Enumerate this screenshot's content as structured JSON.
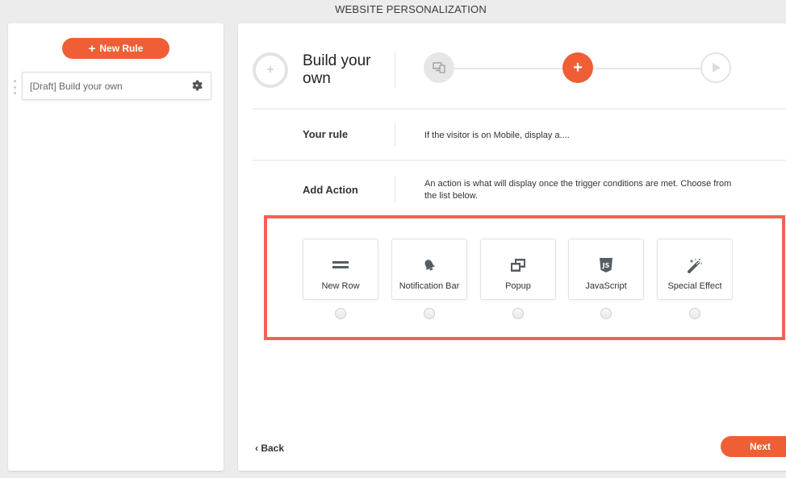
{
  "app": {
    "title": "WEBSITE PERSONALIZATION"
  },
  "sidebar": {
    "new_rule_button": {
      "icon": "plus-icon",
      "label": "New Rule"
    },
    "rules": [
      {
        "label": "[Draft] Build your own",
        "icon": "gear-icon"
      }
    ]
  },
  "main": {
    "header": {
      "icon": "plus-circle-icon",
      "title": "Build your own"
    },
    "stepper": {
      "steps": [
        {
          "name": "devices",
          "icon": "devices-icon",
          "state": "complete"
        },
        {
          "name": "action",
          "icon": "plus-icon",
          "state": "active",
          "glyph": "+"
        },
        {
          "name": "launch",
          "icon": "play-icon",
          "state": "pending"
        }
      ]
    },
    "your_rule": {
      "label": "Your rule",
      "text": "If the visitor is on Mobile, display a...."
    },
    "add_action": {
      "label": "Add Action",
      "text": "An action is what will display once the trigger conditions are met. Choose from the list below."
    },
    "actions": [
      {
        "label": "New Row",
        "icon": "equals-icon",
        "selected": false
      },
      {
        "label": "Notification Bar",
        "icon": "bell-icon",
        "selected": false
      },
      {
        "label": "Popup",
        "icon": "window-restore-icon",
        "selected": false
      },
      {
        "label": "JavaScript",
        "icon": "js-icon",
        "selected": false
      },
      {
        "label": "Special Effect",
        "icon": "magic-wand-icon",
        "selected": false
      }
    ],
    "footer": {
      "back_label": "‹ Back",
      "next_label": "Next"
    }
  },
  "colors": {
    "accent": "#ef5e35",
    "highlight": "#ef6354",
    "background": "#ececec"
  }
}
